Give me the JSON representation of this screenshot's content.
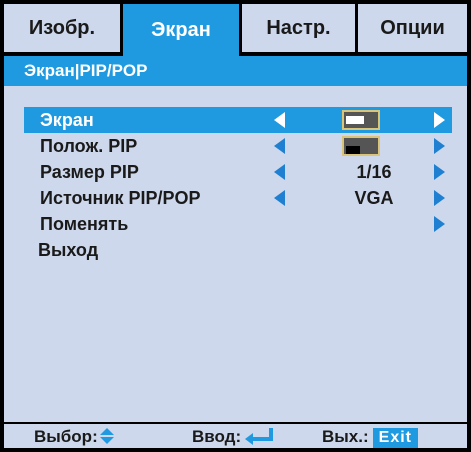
{
  "tabs": [
    "Изобр.",
    "Экран",
    "Настр.",
    "Опции"
  ],
  "breadcrumb": "Экран|PIP/POP",
  "menu": [
    {
      "label": "Экран",
      "value_icon": "wide-screen-thumbnail-icon"
    },
    {
      "label": "Полож. PIP",
      "value_icon": "pip-position-thumbnail-icon"
    },
    {
      "label": "Размер PIP",
      "value": "1/16"
    },
    {
      "label": "Источник PIP/POP",
      "value": "VGA"
    },
    {
      "label": "Поменять"
    },
    {
      "label": "Выход"
    }
  ],
  "footer": {
    "select_label": "Выбор:",
    "enter_label": "Ввод:",
    "exit_label": "Вых.:",
    "exit_key": "Exit"
  },
  "colors": {
    "accent": "#1f9ae0",
    "background": "#cdd8ec",
    "text": "#1a1a1a"
  }
}
